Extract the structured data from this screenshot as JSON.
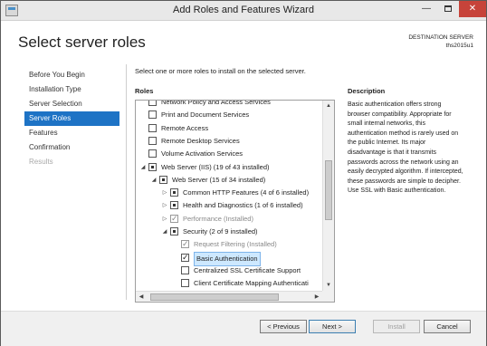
{
  "window": {
    "title": "Add Roles and Features Wizard",
    "minimize": "—",
    "maximize": "",
    "close": "✕"
  },
  "header": {
    "page_title": "Select server roles",
    "destination_label": "DESTINATION SERVER",
    "destination_server": "ths2015u1"
  },
  "nav": {
    "items": [
      {
        "label": "Before You Begin",
        "state": "normal"
      },
      {
        "label": "Installation Type",
        "state": "normal"
      },
      {
        "label": "Server Selection",
        "state": "normal"
      },
      {
        "label": "Server Roles",
        "state": "active"
      },
      {
        "label": "Features",
        "state": "normal"
      },
      {
        "label": "Confirmation",
        "state": "normal"
      },
      {
        "label": "Results",
        "state": "disabled"
      }
    ]
  },
  "main": {
    "instruction": "Select one or more roles to install on the selected server.",
    "roles_heading": "Roles",
    "description_heading": "Description",
    "description_text": "Basic authentication offers strong browser compatibility. Appropriate for small internal networks, this authentication method is rarely used on the public Internet. Its major disadvantage is that it transmits passwords across the network using an easily decrypted algorithm. If intercepted, these passwords are simple to decipher. Use SSL with Basic authentication.",
    "roles": [
      {
        "label": "Network Policy and Access Services",
        "level": 0,
        "expander": "",
        "checkbox": "unchecked",
        "style": "cut"
      },
      {
        "label": "Print and Document Services",
        "level": 0,
        "expander": "",
        "checkbox": "unchecked",
        "style": "normal"
      },
      {
        "label": "Remote Access",
        "level": 0,
        "expander": "",
        "checkbox": "unchecked",
        "style": "normal"
      },
      {
        "label": "Remote Desktop Services",
        "level": 0,
        "expander": "",
        "checkbox": "unchecked",
        "style": "normal"
      },
      {
        "label": "Volume Activation Services",
        "level": 0,
        "expander": "",
        "checkbox": "unchecked",
        "style": "normal"
      },
      {
        "label": "Web Server (IIS) (19 of 43 installed)",
        "level": 0,
        "expander": "◢",
        "checkbox": "partial",
        "style": "normal"
      },
      {
        "label": "Web Server (15 of 34 installed)",
        "level": 1,
        "expander": "◢",
        "checkbox": "partial",
        "style": "normal"
      },
      {
        "label": "Common HTTP Features (4 of 6 installed)",
        "level": 2,
        "expander": "▷",
        "checkbox": "partial",
        "style": "normal"
      },
      {
        "label": "Health and Diagnostics (1 of 6 installed)",
        "level": 2,
        "expander": "▷",
        "checkbox": "partial",
        "style": "normal"
      },
      {
        "label": "Performance (Installed)",
        "level": 2,
        "expander": "▷",
        "checkbox": "checked-gray",
        "style": "dim"
      },
      {
        "label": "Security (2 of 9 installed)",
        "level": 2,
        "expander": "◢",
        "checkbox": "partial",
        "style": "normal"
      },
      {
        "label": "Request Filtering (Installed)",
        "level": 3,
        "expander": "",
        "checkbox": "checked-gray",
        "style": "dim"
      },
      {
        "label": "Basic Authentication",
        "level": 3,
        "expander": "",
        "checkbox": "checked",
        "style": "selected"
      },
      {
        "label": "Centralized SSL Certificate Support",
        "level": 3,
        "expander": "",
        "checkbox": "unchecked",
        "style": "normal"
      },
      {
        "label": "Client Certificate Mapping Authenticati",
        "level": 3,
        "expander": "",
        "checkbox": "unchecked",
        "style": "normal"
      }
    ],
    "scroll_up": "▲",
    "scroll_down": "▼",
    "scroll_left": "◀",
    "scroll_right": "▶"
  },
  "footer": {
    "previous": "< Previous",
    "next": "Next >",
    "install": "Install",
    "cancel": "Cancel"
  }
}
